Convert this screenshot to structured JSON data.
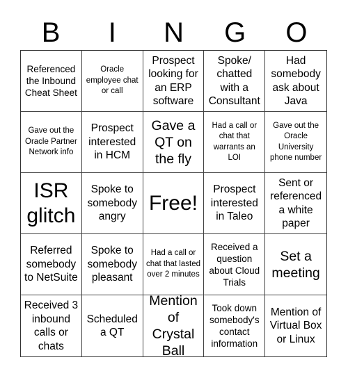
{
  "header": {
    "letters": [
      "B",
      "I",
      "N",
      "G",
      "O"
    ]
  },
  "cells": [
    "Referenced the Inbound Cheat Sheet",
    "Oracle employee chat or call",
    "Prospect looking for an ERP software",
    "Spoke/ chatted with a Consultant",
    "Had somebody ask about Java",
    "Gave out the Oracle Partner Network info",
    "Prospect interested in HCM",
    "Gave a QT on the fly",
    "Had a call or chat that warrants an LOI",
    "Gave out the Oracle University phone number",
    "ISR glitch",
    "Spoke to somebody angry",
    "Free!",
    "Prospect interested in Taleo",
    "Sent or referenced a white paper",
    "Referred somebody to NetSuite",
    "Spoke to somebody pleasant",
    "Had a call or chat that lasted over 2 minutes",
    "Received a question about Cloud Trials",
    "Set a meeting",
    "Received 3 inbound calls or chats",
    "Scheduled a QT",
    "Mention of Crystal Ball",
    "Took down somebody's contact information",
    "Mention of Virtual Box or Linux"
  ]
}
